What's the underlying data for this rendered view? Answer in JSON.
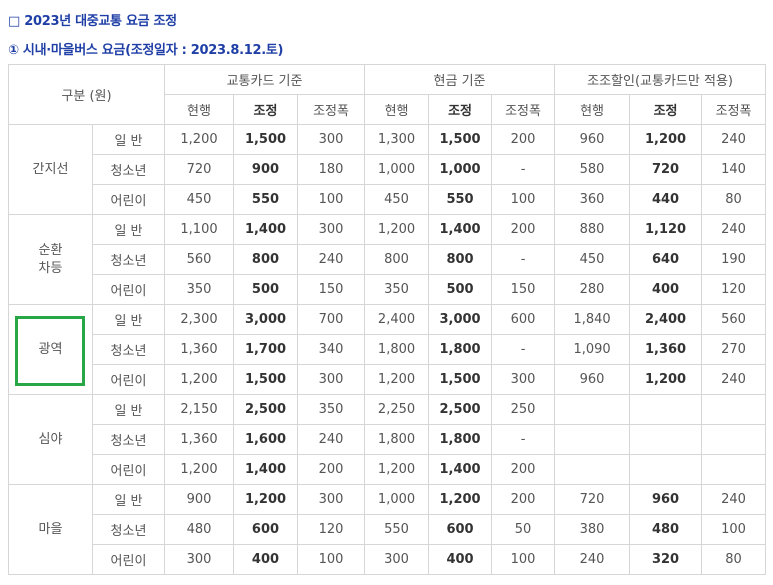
{
  "heading": "□ 2023년 대중교통 요금 조정",
  "subheading": "① 시내·마을버스 요금(조정일자 : 2023.8.12.토)",
  "table": {
    "corner_label": "구분 (원)",
    "groups": [
      "교통카드 기준",
      "현금 기준",
      "조조할인(교통카드만 적용)"
    ],
    "subcols": [
      "현행",
      "조정",
      "조정폭",
      "현행",
      "조정",
      "조정폭",
      "현행",
      "조정",
      "조정폭"
    ],
    "sections": [
      {
        "name": "간지선",
        "rows": [
          {
            "type": "일 반",
            "v": [
              "1,200",
              "1,500",
              "300",
              "1,300",
              "1,500",
              "200",
              "960",
              "1,200",
              "240"
            ]
          },
          {
            "type": "청소년",
            "v": [
              "720",
              "900",
              "180",
              "1,000",
              "1,000",
              "-",
              "580",
              "720",
              "140"
            ]
          },
          {
            "type": "어린이",
            "v": [
              "450",
              "550",
              "100",
              "450",
              "550",
              "100",
              "360",
              "440",
              "80"
            ]
          }
        ]
      },
      {
        "name": "순환\n차등",
        "rows": [
          {
            "type": "일 반",
            "v": [
              "1,100",
              "1,400",
              "300",
              "1,200",
              "1,400",
              "200",
              "880",
              "1,120",
              "240"
            ]
          },
          {
            "type": "청소년",
            "v": [
              "560",
              "800",
              "240",
              "800",
              "800",
              "-",
              "450",
              "640",
              "190"
            ]
          },
          {
            "type": "어린이",
            "v": [
              "350",
              "500",
              "150",
              "350",
              "500",
              "150",
              "280",
              "400",
              "120"
            ]
          }
        ]
      },
      {
        "name": "광역",
        "rows": [
          {
            "type": "일 반",
            "v": [
              "2,300",
              "3,000",
              "700",
              "2,400",
              "3,000",
              "600",
              "1,840",
              "2,400",
              "560"
            ]
          },
          {
            "type": "청소년",
            "v": [
              "1,360",
              "1,700",
              "340",
              "1,800",
              "1,800",
              "-",
              "1,090",
              "1,360",
              "270"
            ]
          },
          {
            "type": "어린이",
            "v": [
              "1,200",
              "1,500",
              "300",
              "1,200",
              "1,500",
              "300",
              "960",
              "1,200",
              "240"
            ]
          }
        ]
      },
      {
        "name": "심야",
        "rows": [
          {
            "type": "일 반",
            "v": [
              "2,150",
              "2,500",
              "350",
              "2,250",
              "2,500",
              "250",
              "",
              "",
              ""
            ]
          },
          {
            "type": "청소년",
            "v": [
              "1,360",
              "1,600",
              "240",
              "1,800",
              "1,800",
              "-",
              "",
              "",
              ""
            ]
          },
          {
            "type": "어린이",
            "v": [
              "1,200",
              "1,400",
              "200",
              "1,200",
              "1,400",
              "200",
              "",
              "",
              ""
            ]
          }
        ]
      },
      {
        "name": "마을",
        "rows": [
          {
            "type": "일 반",
            "v": [
              "900",
              "1,200",
              "300",
              "1,000",
              "1,200",
              "200",
              "720",
              "960",
              "240"
            ]
          },
          {
            "type": "청소년",
            "v": [
              "480",
              "600",
              "120",
              "550",
              "600",
              "50",
              "380",
              "480",
              "100"
            ]
          },
          {
            "type": "어린이",
            "v": [
              "300",
              "400",
              "100",
              "300",
              "400",
              "100",
              "240",
              "320",
              "80"
            ]
          }
        ]
      }
    ]
  },
  "highlight_color": "#27a745"
}
